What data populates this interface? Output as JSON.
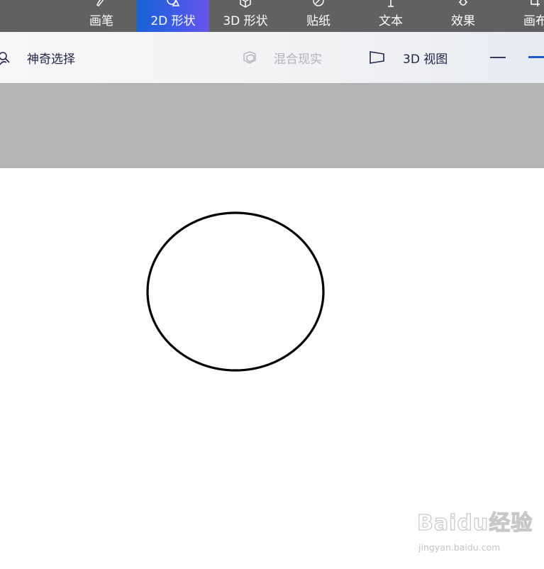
{
  "tabs": [
    {
      "label": "画笔",
      "icon": "brush-icon",
      "active": false
    },
    {
      "label": "2D 形状",
      "icon": "shapes-2d-icon",
      "active": true
    },
    {
      "label": "3D 形状",
      "icon": "cube-icon",
      "active": false
    },
    {
      "label": "贴纸",
      "icon": "sticker-icon",
      "active": false
    },
    {
      "label": "文本",
      "icon": "text-icon",
      "active": false
    },
    {
      "label": "效果",
      "icon": "effects-sun-icon",
      "active": false
    },
    {
      "label": "画布",
      "icon": "canvas-crop-icon",
      "active": false
    }
  ],
  "toolbar": {
    "magic_select": "神奇选择",
    "mixed_reality": "混合现实",
    "view_3d": "3D 视图"
  },
  "watermark": {
    "logo": "Baidu经验",
    "url": "jingyan.baidu.com"
  },
  "colors": {
    "topbar": "#616063",
    "active_tab_start": "#1763d6",
    "active_tab_end": "#6a55ec",
    "toolbar_text": "#23254a",
    "disabled_text": "#b1b3b8",
    "workspace": "#b4b5b4",
    "canvas": "#ffffff",
    "shape_stroke": "#000000"
  }
}
